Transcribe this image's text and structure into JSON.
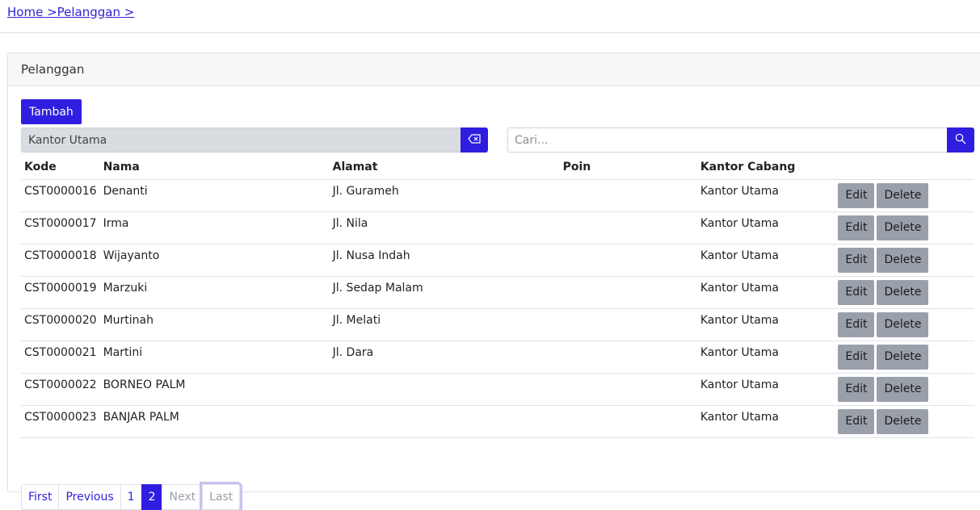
{
  "breadcrumb": {
    "home": "Home >",
    "current": "Pelanggan >"
  },
  "card": {
    "title": "Pelanggan"
  },
  "toolbar": {
    "add_label": "Tambah"
  },
  "filter": {
    "branch_value": "Kantor Utama",
    "search_placeholder": "Cari..."
  },
  "table": {
    "headers": [
      "Kode",
      "Nama",
      "Alamat",
      "Poin",
      "Kantor Cabang"
    ],
    "rows": [
      {
        "kode": "CST0000016",
        "nama": "Denanti",
        "alamat": "Jl. Gurameh",
        "poin": "",
        "cabang": "Kantor Utama"
      },
      {
        "kode": "CST0000017",
        "nama": "Irma",
        "alamat": "Jl. Nila",
        "poin": "",
        "cabang": "Kantor Utama"
      },
      {
        "kode": "CST0000018",
        "nama": "Wijayanto",
        "alamat": "Jl. Nusa Indah",
        "poin": "",
        "cabang": "Kantor Utama"
      },
      {
        "kode": "CST0000019",
        "nama": "Marzuki",
        "alamat": "Jl. Sedap Malam",
        "poin": "",
        "cabang": "Kantor Utama"
      },
      {
        "kode": "CST0000020",
        "nama": "Murtinah",
        "alamat": "Jl. Melati",
        "poin": "",
        "cabang": "Kantor Utama"
      },
      {
        "kode": "CST0000021",
        "nama": "Martini",
        "alamat": "Jl. Dara",
        "poin": "",
        "cabang": "Kantor Utama"
      },
      {
        "kode": "CST0000022",
        "nama": "BORNEO PALM",
        "alamat": "",
        "poin": "",
        "cabang": "Kantor Utama"
      },
      {
        "kode": "CST0000023",
        "nama": "BANJAR PALM",
        "alamat": "",
        "poin": "",
        "cabang": "Kantor Utama"
      }
    ],
    "edit_label": "Edit",
    "delete_label": "Delete"
  },
  "pagination": {
    "first": "First",
    "previous": "Previous",
    "page1": "1",
    "page2": "2",
    "next": "Next",
    "last": "Last"
  },
  "icons": {
    "clear": "backspace-icon",
    "search": "search-icon"
  },
  "colors": {
    "primary": "#2f1ee0",
    "secondary": "#9aa0aa"
  }
}
